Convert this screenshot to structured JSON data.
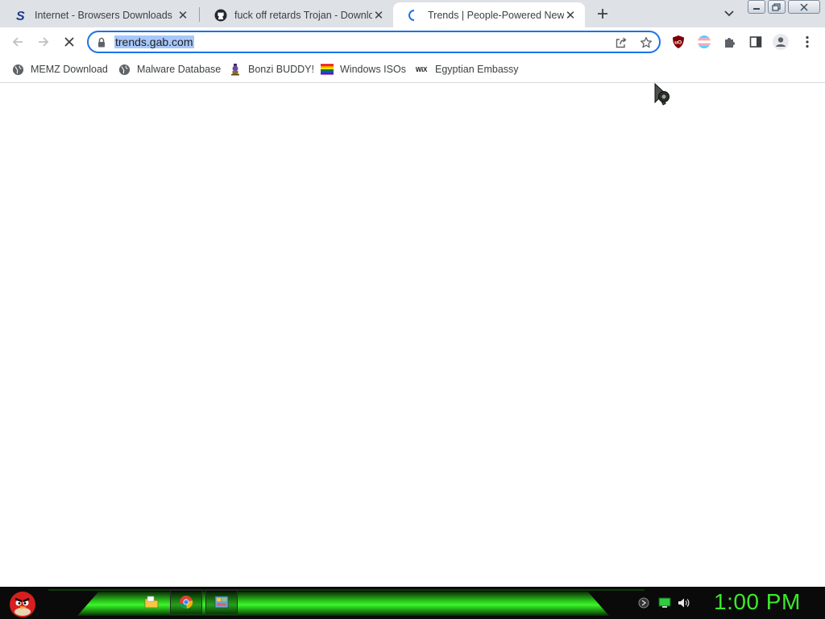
{
  "browser": {
    "tabs": [
      {
        "title": "Internet - Browsers Downloads",
        "icon": "softpedia-s-icon"
      },
      {
        "title": "fuck off retards Trojan - Downloa",
        "icon": "github-icon"
      },
      {
        "title": "Trends | People-Powered News",
        "icon": "loading-spinner-icon",
        "active": true
      }
    ],
    "url": "trends.gab.com",
    "bookmarks": [
      {
        "label": "MEMZ Download",
        "icon": "globe-icon"
      },
      {
        "label": "Malware Database",
        "icon": "globe-icon"
      },
      {
        "label": "Bonzi BUDDY!",
        "icon": "bonzi-icon"
      },
      {
        "label": "Windows ISOs",
        "icon": "rainbow-flag-icon"
      },
      {
        "label": "Egyptian Embassy",
        "icon": "wix-icon"
      }
    ],
    "wix_text": "WiX",
    "ublock_text": "uO"
  },
  "taskbar": {
    "clock": "1:00 PM"
  },
  "colors": {
    "accent": "#1a73e8",
    "selection": "#a8c7fa",
    "taskbar_green": "#3ce82a"
  }
}
